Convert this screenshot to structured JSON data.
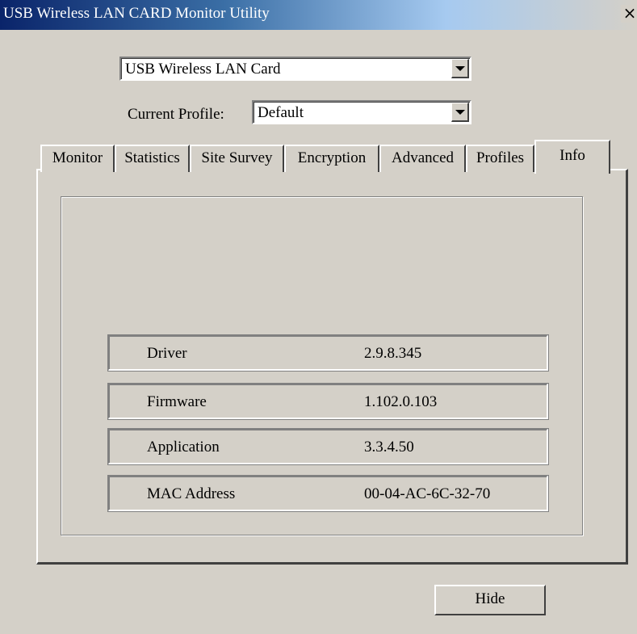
{
  "window": {
    "title": "USB Wireless LAN CARD Monitor Utility",
    "close_label": "×"
  },
  "device_select": {
    "value": "USB Wireless LAN Card"
  },
  "profile": {
    "label": "Current Profile:",
    "value": "Default"
  },
  "tabs": [
    {
      "label": "Monitor"
    },
    {
      "label": "Statistics"
    },
    {
      "label": "Site Survey"
    },
    {
      "label": "Encryption"
    },
    {
      "label": "Advanced"
    },
    {
      "label": "Profiles"
    },
    {
      "label": "Info",
      "active": true
    }
  ],
  "info": {
    "rows": [
      {
        "label": "Driver",
        "value": "2.9.8.345"
      },
      {
        "label": "Firmware",
        "value": "1.102.0.103"
      },
      {
        "label": "Application",
        "value": "3.3.4.50"
      },
      {
        "label": "MAC Address",
        "value": "00-04-AC-6C-32-70"
      }
    ]
  },
  "buttons": {
    "hide": "Hide"
  },
  "colors": {
    "face": "#d4d0c8",
    "title_start": "#0a246a",
    "title_end": "#a6caf0"
  }
}
